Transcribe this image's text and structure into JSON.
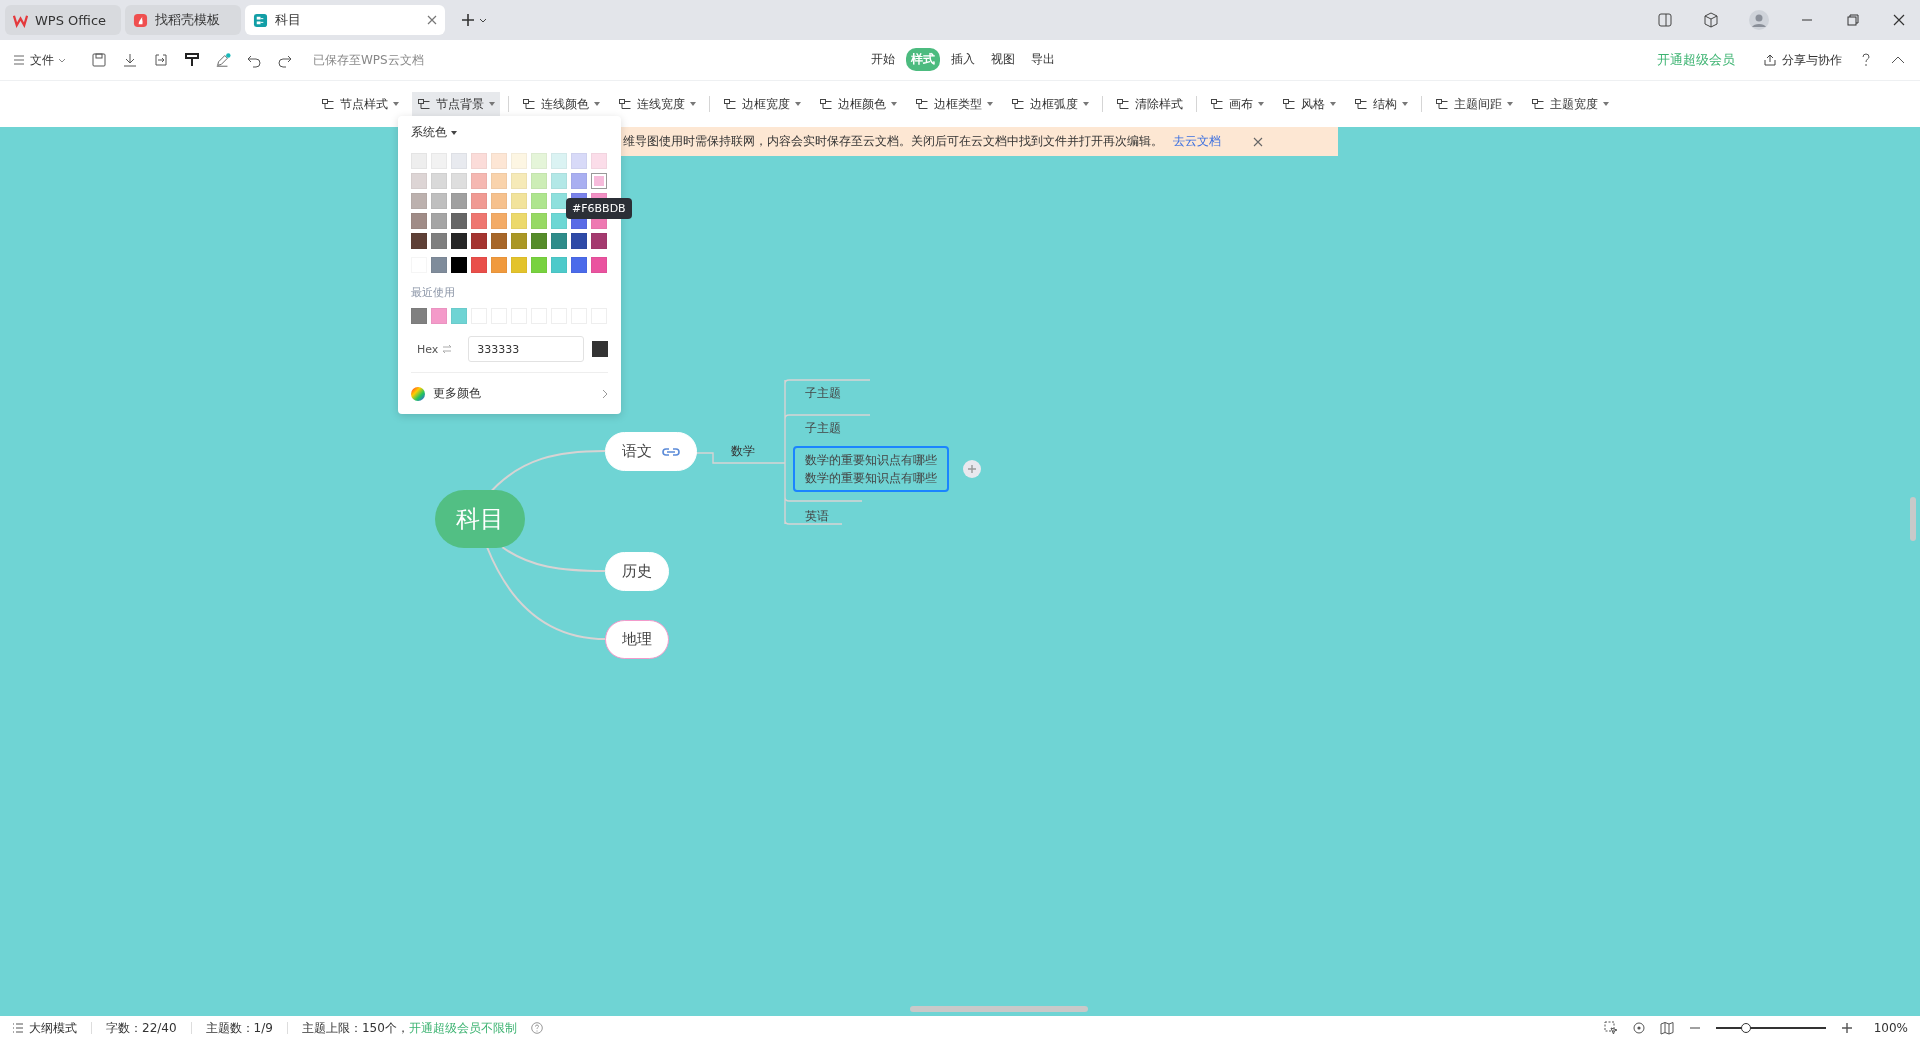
{
  "tabs": [
    {
      "label": "WPS Office",
      "kind": "home",
      "selected": false
    },
    {
      "label": "找稻壳模板",
      "kind": "template",
      "selected": false
    },
    {
      "label": "科目",
      "kind": "doc",
      "selected": true
    }
  ],
  "toolbar": {
    "file_menu": "文件",
    "save_status": "已保存至WPS云文档",
    "ribbon_tabs": [
      {
        "label": "开始",
        "selected": false
      },
      {
        "label": "样式",
        "selected": true
      },
      {
        "label": "插入",
        "selected": false
      },
      {
        "label": "视图",
        "selected": false
      },
      {
        "label": "导出",
        "selected": false
      }
    ],
    "upgrade": "开通超级会员",
    "share": "分享与协作"
  },
  "style_toolbar": [
    [
      {
        "label": "节点样式",
        "selected": false,
        "dropdown": true
      },
      {
        "label": "节点背景",
        "selected": true,
        "dropdown": true
      }
    ],
    [
      {
        "label": "连线颜色",
        "selected": false,
        "dropdown": true
      },
      {
        "label": "连线宽度",
        "selected": false,
        "dropdown": true
      }
    ],
    [
      {
        "label": "边框宽度",
        "selected": false,
        "dropdown": true
      },
      {
        "label": "边框颜色",
        "selected": false,
        "dropdown": true
      },
      {
        "label": "边框类型",
        "selected": false,
        "dropdown": true
      },
      {
        "label": "边框弧度",
        "selected": false,
        "dropdown": true
      }
    ],
    [
      {
        "label": "清除样式",
        "selected": false,
        "dropdown": false
      }
    ],
    [
      {
        "label": "画布",
        "selected": false,
        "dropdown": true
      },
      {
        "label": "风格",
        "selected": false,
        "dropdown": true
      },
      {
        "label": "结构",
        "selected": false,
        "dropdown": true
      }
    ],
    [
      {
        "label": "主题间距",
        "selected": false,
        "dropdown": true
      },
      {
        "label": "主题宽度",
        "selected": false,
        "dropdown": true
      }
    ]
  ],
  "color_popup": {
    "palette_name": "系统色",
    "swatches": [
      [
        {
          "color": "#eeeeee",
          "selected": false
        },
        {
          "color": "#f2f2f2",
          "selected": false
        },
        {
          "color": "#e8eaef",
          "selected": false
        },
        {
          "color": "#fbdcd9",
          "selected": false
        },
        {
          "color": "#fde6d5",
          "selected": false
        },
        {
          "color": "#fdf6e3",
          "selected": false
        },
        {
          "color": "#e5f5d9",
          "selected": false
        },
        {
          "color": "#dbf3f3",
          "selected": false
        },
        {
          "color": "#d8daf8",
          "selected": false
        },
        {
          "color": "#fbdde9",
          "selected": false
        }
      ],
      [
        {
          "color": "#ddd5d5",
          "selected": false
        },
        {
          "color": "#d9d9d9",
          "selected": false
        },
        {
          "color": "#dedede",
          "selected": false
        },
        {
          "color": "#f5b8b2",
          "selected": false
        },
        {
          "color": "#f9d3ac",
          "selected": false
        },
        {
          "color": "#f6eab8",
          "selected": false
        },
        {
          "color": "#cdedb6",
          "selected": false
        },
        {
          "color": "#b3e8e7",
          "selected": false
        },
        {
          "color": "#a9aff1",
          "selected": false
        },
        {
          "color": "#f6bbdb",
          "selected": true
        }
      ],
      [
        {
          "color": "#bcb1ae",
          "selected": false
        },
        {
          "color": "#bfbfbf",
          "selected": false
        },
        {
          "color": "#a0a0a0",
          "selected": false
        },
        {
          "color": "#f09a93",
          "selected": false
        },
        {
          "color": "#f6c18d",
          "selected": false
        },
        {
          "color": "#f2e39b",
          "selected": false
        },
        {
          "color": "#aee58e",
          "selected": false
        },
        {
          "color": "#8ee0dd",
          "selected": false
        },
        {
          "color": "#7a83ea",
          "selected": false
        },
        {
          "color": "#f290c4",
          "selected": false
        }
      ],
      [
        {
          "color": "#a08c87",
          "selected": false
        },
        {
          "color": "#a5a5a5",
          "selected": false
        },
        {
          "color": "#666666",
          "selected": false
        },
        {
          "color": "#ee7670",
          "selected": false
        },
        {
          "color": "#f3ab66",
          "selected": false
        },
        {
          "color": "#ecd96b",
          "selected": false
        },
        {
          "color": "#97d964",
          "selected": false
        },
        {
          "color": "#6dd7d4",
          "selected": false
        },
        {
          "color": "#5a6be6",
          "selected": false
        },
        {
          "color": "#ee79b2",
          "selected": false
        }
      ],
      [
        {
          "color": "#5e4037",
          "selected": false
        },
        {
          "color": "#7f7f7f",
          "selected": false
        },
        {
          "color": "#262626",
          "selected": false
        },
        {
          "color": "#a43430",
          "selected": false
        },
        {
          "color": "#a76628",
          "selected": false
        },
        {
          "color": "#aa9725",
          "selected": false
        },
        {
          "color": "#558c2a",
          "selected": false
        },
        {
          "color": "#2e8c8a",
          "selected": false
        },
        {
          "color": "#2e4aa7",
          "selected": false
        },
        {
          "color": "#a43a6f",
          "selected": false
        }
      ],
      [
        {
          "color": "#ffffff",
          "selected": false
        },
        {
          "color": "#7f8c9b",
          "selected": false
        },
        {
          "color": "#000000",
          "selected": false
        },
        {
          "color": "#e94f4a",
          "selected": false
        },
        {
          "color": "#f09a3e",
          "selected": false
        },
        {
          "color": "#e3c32c",
          "selected": false
        },
        {
          "color": "#78d23f",
          "selected": false
        },
        {
          "color": "#4dcaca",
          "selected": false
        },
        {
          "color": "#4b6bea",
          "selected": false
        },
        {
          "color": "#ea539f",
          "selected": false
        }
      ]
    ],
    "tooltip": "#F6BBDB",
    "recent_label": "最近使用",
    "recent": [
      {
        "kind": "color",
        "color": "#808080"
      },
      {
        "kind": "color",
        "color": "#f49ac9"
      },
      {
        "kind": "color",
        "color": "#6fd4d4"
      },
      {
        "kind": "empty"
      },
      {
        "kind": "empty"
      },
      {
        "kind": "empty"
      },
      {
        "kind": "empty"
      },
      {
        "kind": "empty"
      },
      {
        "kind": "empty"
      },
      {
        "kind": "empty"
      }
    ],
    "hex_label": "Hex",
    "hex_value": "333333",
    "more_colors": "更多颜色"
  },
  "banner": {
    "text": "维导图使用时需保持联网，内容会实时保存至云文档。关闭后可在云文档中找到文件并打开再次编辑。",
    "link": "去云文档"
  },
  "mindmap": {
    "root": "科目",
    "branches": [
      {
        "label": "语文",
        "has_link": true,
        "highlighted": false,
        "children": [
          {
            "label": "数学",
            "children": [
              {
                "lines": [
                  "子主题"
                ],
                "selected": false
              },
              {
                "lines": [
                  "子主题"
                ],
                "selected": false
              },
              {
                "lines": [
                  "数学的重要知识点有哪些",
                  "数学的重要知识点有哪些"
                ],
                "selected": true
              },
              {
                "lines": [
                  "英语"
                ],
                "selected": false
              }
            ]
          }
        ]
      },
      {
        "label": "历史",
        "has_link": false,
        "highlighted": false
      },
      {
        "label": "地理",
        "has_link": false,
        "highlighted": true
      }
    ]
  },
  "status_bar": {
    "outline_mode": "大纲模式",
    "word_count": "字数：22/40",
    "topic_count": "主题数：1/9",
    "topic_limit": "主题上限：150个，",
    "upgrade_link": "开通超级会员不限制",
    "zoom": {
      "level": 0.28,
      "reading": "100%"
    }
  }
}
